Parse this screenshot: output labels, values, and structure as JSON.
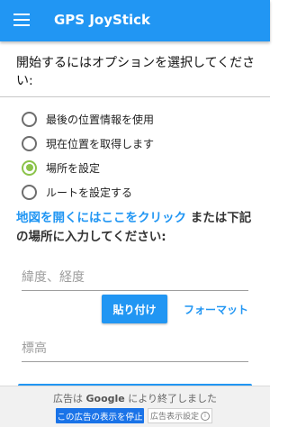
{
  "app": {
    "title": "GPS JoyStick"
  },
  "prompt": "開始するにはオプションを選択してください:",
  "options": [
    {
      "label": "最後の位置情報を使用",
      "checked": false
    },
    {
      "label": "現在位置を取得します",
      "checked": false
    },
    {
      "label": "場所を設定",
      "checked": true
    },
    {
      "label": "ルートを設定する",
      "checked": false
    }
  ],
  "map": {
    "link": "地図を開くにはここをクリック",
    "rest": " または下記の場所に入力してください:"
  },
  "coords": {
    "placeholder": "緯度、経度",
    "value": ""
  },
  "buttons": {
    "paste": "貼り付け",
    "format": "フォーマット"
  },
  "altitude": {
    "placeholder": "標高",
    "value": ""
  },
  "ad": {
    "line_prefix": "広告は",
    "line_brand": "Google",
    "line_suffix": "により終了しました",
    "stop": "この広告の表示を停止",
    "settings": "広告表示設定",
    "settings_icon": "info-icon"
  },
  "colors": {
    "primary": "#2196f3",
    "radio_checked": "#8bc34a"
  }
}
